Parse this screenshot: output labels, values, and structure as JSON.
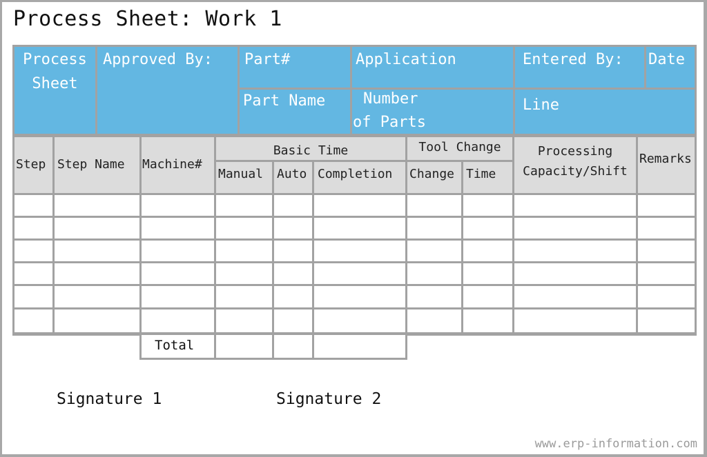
{
  "title": "Process Sheet: Work 1",
  "header_block": {
    "process_sheet": [
      "Process",
      "Sheet"
    ],
    "approved_by": "Approved By:",
    "part_number": "Part#",
    "part_name": "Part Name",
    "application": "Application",
    "number_of_parts": [
      "Number",
      "of Parts"
    ],
    "entered_by": "Entered By:",
    "date": "Date",
    "line": "Line"
  },
  "table": {
    "columns": {
      "step": "Step",
      "step_name": "Step Name",
      "machine": "Machine#",
      "basic_time": "Basic Time",
      "manual": "Manual",
      "auto": "Auto",
      "completion": "Completion",
      "tool_change": "Tool Change",
      "change": "Change",
      "time": "Time",
      "processing_capacity": [
        "Processing",
        "Capacity/Shift"
      ],
      "remarks": "Remarks"
    },
    "row_count": 6,
    "total_label": "Total"
  },
  "signatures": [
    "Signature 1",
    "Signature 2"
  ],
  "watermark": "www.erp-information.com",
  "colors": {
    "header_blue": "#63b7e2",
    "column_header_gray": "#dcdcdc",
    "grid_line": "#a2a2a2"
  }
}
